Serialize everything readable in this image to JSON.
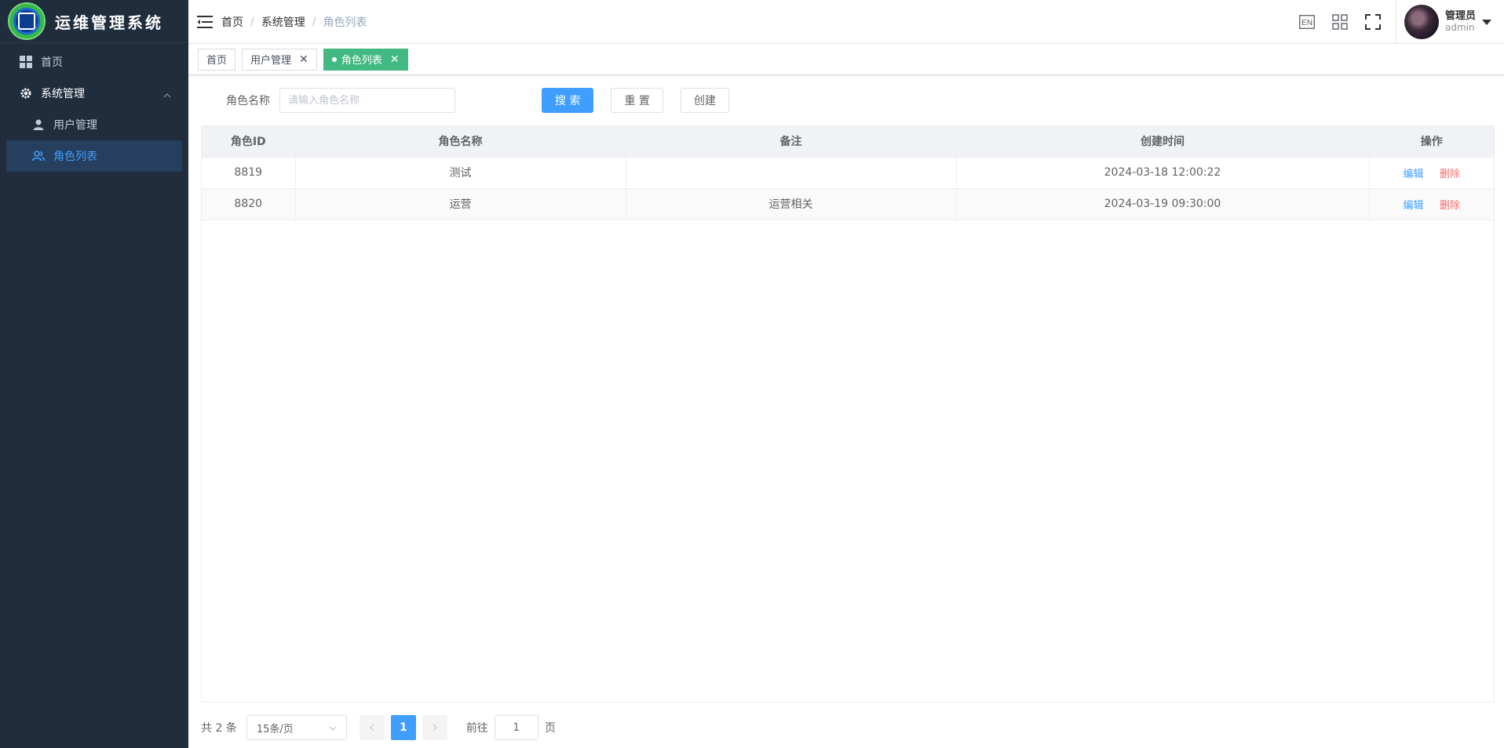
{
  "app": {
    "title": "运维管理系统"
  },
  "sidebar": {
    "items": [
      {
        "label": "首页",
        "icon": "dashboard-grid-icon"
      },
      {
        "label": "系统管理",
        "icon": "gear-icon"
      },
      {
        "label": "用户管理",
        "icon": "user-icon"
      },
      {
        "label": "角色列表",
        "icon": "users-icon"
      }
    ]
  },
  "breadcrumb": [
    "首页",
    "系统管理",
    "角色列表"
  ],
  "header": {
    "lang_label": "EN",
    "user_name": "管理员",
    "user_sub": "admin"
  },
  "tags": [
    {
      "label": "首页"
    },
    {
      "label": "用户管理"
    },
    {
      "label": "角色列表"
    }
  ],
  "filter": {
    "label": "角色名称",
    "placeholder": "请输入角色名称",
    "search_label": "搜 索",
    "reset_label": "重 置",
    "create_label": "创建"
  },
  "table": {
    "headers": [
      "角色ID",
      "角色名称",
      "备注",
      "创建时间",
      "操作"
    ],
    "rows": [
      [
        "8819",
        "测试",
        "",
        "2024-03-18 12:00:22"
      ],
      [
        "8820",
        "运营",
        "运营相关",
        "2024-03-19 09:30:00"
      ]
    ],
    "edit_label": "编辑",
    "delete_label": "删除"
  },
  "pagination": {
    "total": "共 2 条",
    "page_size": "15条/页",
    "current": "1",
    "goto_label": "前往",
    "goto_value": "1",
    "page_suffix": "页"
  },
  "colors": {
    "sidebar_bg": "#1f2d3d",
    "accent": "#409eff",
    "tag_active": "#42b983",
    "danger": "#f56c6c"
  }
}
